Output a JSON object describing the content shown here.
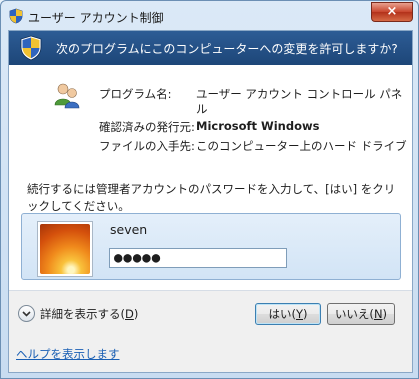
{
  "window": {
    "title": "ユーザー アカウント制御",
    "close_label": "×"
  },
  "banner": {
    "text": "次のプログラムにこのコンピューターへの変更を許可しますか?"
  },
  "program_info": {
    "name_label": "プログラム名:",
    "name_value_line1": "ユーザー アカウント コントロール パネ",
    "name_value_line2": "ル",
    "publisher_label": "確認済みの発行元:",
    "publisher_value": "Microsoft Windows",
    "origin_label": "ファイルの入手先:",
    "origin_value": "このコンピューター上のハード ドライブ"
  },
  "prompt": {
    "text": "続行するには管理者アカウントのパスワードを入力して、[はい] をクリックしてください。"
  },
  "credential": {
    "username": "seven",
    "password_mask": "●●●●●"
  },
  "footer": {
    "details_text": "詳細を表示する(",
    "details_mnemonic": "D",
    "details_suffix": ")",
    "yes_text": "はい(",
    "yes_mnemonic": "Y",
    "yes_suffix": ")",
    "no_text": "いいえ(",
    "no_mnemonic": "N",
    "no_suffix": ")",
    "help_link": "ヘルプを表示します"
  },
  "icons": {
    "title": "uac-shield-icon",
    "banner": "uac-shield-icon",
    "program": "users-icon",
    "details": "chevron-down-icon",
    "avatar": "user-avatar-flower"
  },
  "colors": {
    "banner_bg": "#1d4678",
    "link": "#1a5fb4",
    "close_button": "#c8452c"
  }
}
